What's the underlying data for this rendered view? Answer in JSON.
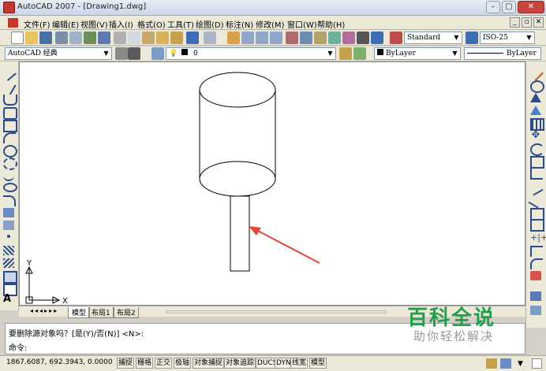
{
  "window": {
    "title": "AutoCAD 2007 - [Drawing1.dwg]",
    "minimize": "–",
    "maximize": "▢",
    "close": "✕"
  },
  "menu": {
    "items": [
      "文件(F)",
      "编辑(E)",
      "视图(V)",
      "插入(I)",
      "格式(O)",
      "工具(T)",
      "绘图(D)",
      "标注(N)",
      "修改(M)",
      "窗口(W)",
      "帮助(H)"
    ],
    "mdi": [
      "_",
      "▫",
      "✕"
    ]
  },
  "toolbar": {
    "text_style": "Standard",
    "dim_style": "ISO-25"
  },
  "toolbar2": {
    "workspace": "AutoCAD 经典",
    "layer": "0",
    "color": "ByLayer",
    "linetype": "ByLayer"
  },
  "ucs": {
    "x_label": "X",
    "y_label": "Y"
  },
  "tabs": {
    "items": [
      "模型",
      "布局1",
      "布局2"
    ]
  },
  "command": {
    "line1": "要删除源对象吗？[是(Y)/否(N)] <N>:",
    "line2": "命令:"
  },
  "status": {
    "coords": "1867.6087, 692.3943, 0.0000",
    "buttons": [
      "捕捉",
      "栅格",
      "正交",
      "极轴",
      "对象捕捉",
      "对象追踪",
      "DUCS",
      "DYN",
      "线宽",
      "模型"
    ]
  },
  "watermark": {
    "main": "百科全说",
    "sub": "助你轻松解决"
  },
  "colors": {
    "arrow": "#e2473c",
    "watermark": "#21a04b"
  }
}
